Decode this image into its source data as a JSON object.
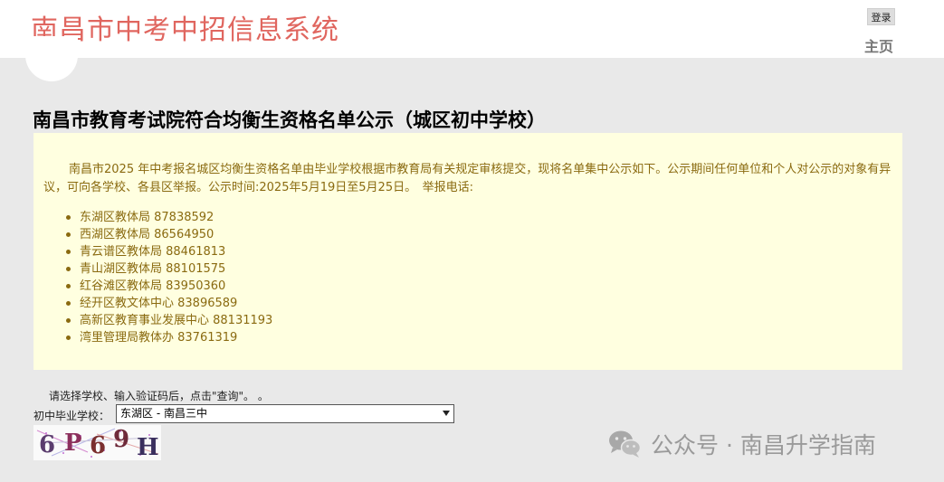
{
  "header": {
    "site_title": "南昌市中考中招信息系统",
    "login_label": "登录",
    "home_label": "主页"
  },
  "page_heading": "南昌市教育考试院符合均衡生资格名单公示（城区初中学校）",
  "notice": {
    "paragraph": "南昌市2025 年中考报名城区均衡生资格名单由毕业学校根据市教育局有关规定审核提交，现将名单集中公示如下。公示期间任何单位和个人对公示的对象有异议，可向各学校、各县区举报。公示时间:2025年5月19日至5月25日。　举报电话:",
    "phones": [
      "东湖区教体局 87838592",
      "西湖区教体局 86564950",
      "青云谱区教体局 88461813",
      "青山湖区教体局 88101575",
      "红谷滩区教体局 83950360",
      "经开区教文体中心 83896589",
      "高新区教育事业发展中心 88131193",
      "湾里管理局教体办 83761319"
    ]
  },
  "form": {
    "instructions": "请选择学校、输入验证码后，点击\"查询\"。 。",
    "school_label": "初中毕业学校：",
    "school_selected": "东湖区 - 南昌三中",
    "captcha_text": "6P69H"
  },
  "watermark": {
    "text": "公众号 · 南昌升学指南",
    "icon": "wechat-icon"
  },
  "colors": {
    "title_red": "#e0665f",
    "notice_bg": "#ffffe0",
    "notice_text": "#8a6a10",
    "page_bg": "#e9e9e9"
  }
}
